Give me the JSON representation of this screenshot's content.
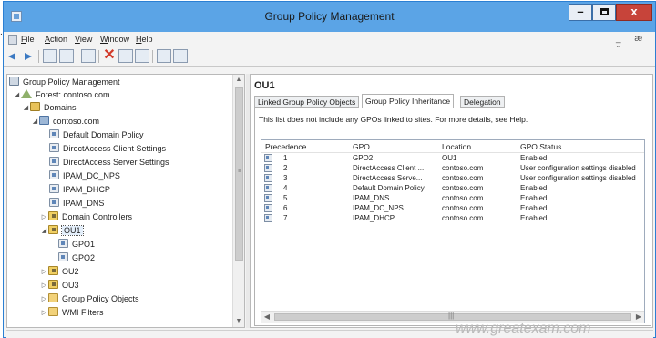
{
  "window": {
    "title": "Group Policy Management"
  },
  "window_controls": {
    "minimize": "–",
    "close": "x"
  },
  "menu": {
    "items": [
      "File",
      "Action",
      "View",
      "Window",
      "Help"
    ],
    "mdi_controls": "_ æ ×"
  },
  "tree": {
    "items": [
      {
        "label": "Group Policy Management",
        "icon": "gpm-icon"
      },
      {
        "label": "Forest: contoso.com",
        "icon": "forest-icon"
      },
      {
        "label": "Domains",
        "icon": "domains-icon"
      },
      {
        "label": "contoso.com",
        "icon": "domain-icon"
      },
      {
        "label": "Default Domain Policy",
        "icon": "gpo-link-icon"
      },
      {
        "label": "DirectAccess Client Settings",
        "icon": "gpo-link-icon"
      },
      {
        "label": "DirectAccess Server Settings",
        "icon": "gpo-link-icon"
      },
      {
        "label": "IPAM_DC_NPS",
        "icon": "gpo-link-icon"
      },
      {
        "label": "IPAM_DHCP",
        "icon": "gpo-link-icon"
      },
      {
        "label": "IPAM_DNS",
        "icon": "gpo-link-icon"
      },
      {
        "label": "Domain Controllers",
        "icon": "ou-icon"
      },
      {
        "label": "OU1",
        "icon": "ou-icon"
      },
      {
        "label": "GPO1",
        "icon": "gpo-link-icon"
      },
      {
        "label": "GPO2",
        "icon": "gpo-link-icon"
      },
      {
        "label": "OU2",
        "icon": "ou-icon"
      },
      {
        "label": "OU3",
        "icon": "ou-icon"
      },
      {
        "label": "Group Policy Objects",
        "icon": "folder-icon"
      },
      {
        "label": "WMI Filters",
        "icon": "folder-icon"
      }
    ]
  },
  "details": {
    "title": "OU1",
    "tabs": [
      "Linked Group Policy Objects",
      "Group Policy Inheritance",
      "Delegation"
    ],
    "active_tab": "Group Policy Inheritance",
    "info": "This list does not include any GPOs linked to sites. For more details, see Help.",
    "columns": [
      "Precedence",
      "GPO",
      "Location",
      "GPO Status"
    ],
    "rows": [
      {
        "precedence": "1",
        "gpo": "GPO2",
        "location": "OU1",
        "status": "Enabled"
      },
      {
        "precedence": "2",
        "gpo": "DirectAccess Client ...",
        "location": "contoso.com",
        "status": "User configuration settings disabled"
      },
      {
        "precedence": "3",
        "gpo": "DirectAccess Serve...",
        "location": "contoso.com",
        "status": "User configuration settings disabled"
      },
      {
        "precedence": "4",
        "gpo": "Default Domain Policy",
        "location": "contoso.com",
        "status": "Enabled"
      },
      {
        "precedence": "5",
        "gpo": "IPAM_DNS",
        "location": "contoso.com",
        "status": "Enabled"
      },
      {
        "precedence": "6",
        "gpo": "IPAM_DC_NPS",
        "location": "contoso.com",
        "status": "Enabled"
      },
      {
        "precedence": "7",
        "gpo": "IPAM_DHCP",
        "location": "contoso.com",
        "status": "Enabled"
      }
    ]
  },
  "watermark": "www.greatexam.com",
  "colors": {
    "titlebar": "#5ba4e6",
    "close_button": "#c7443a",
    "toolbar_arrow": "#3b79c2"
  }
}
